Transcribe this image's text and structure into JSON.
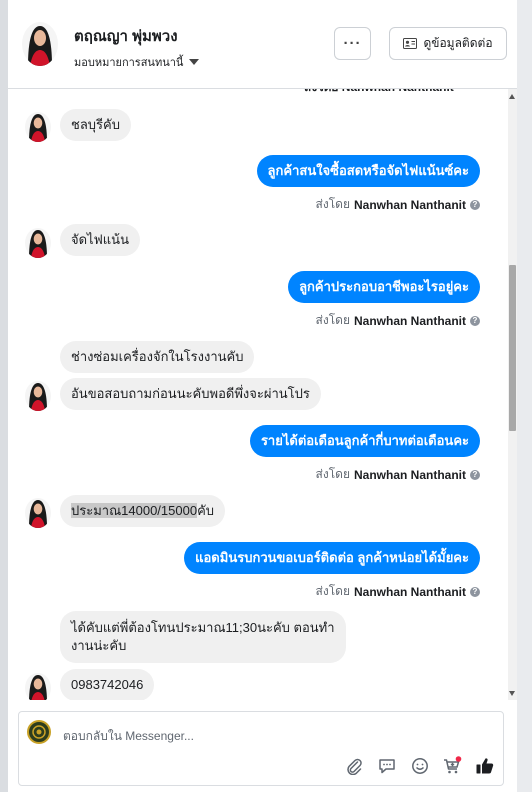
{
  "header": {
    "name": "ตฤณญา พุ่มพวง",
    "assign_label": "มอบหมายการสนทนานี้",
    "more_label": "···",
    "contact_label": "ดูข้อมูลติดต่อ"
  },
  "chat": {
    "top_partial_sentby": "ส่งโดย Nanwhan Nanthanit",
    "messages": [
      {
        "dir": "in",
        "text": "ชลบุรีคับ"
      },
      {
        "dir": "out",
        "text": "ลูกค้าสนใจซื้อสดหรือจัดไฟแน้นซ์คะ",
        "sent_by_prefix": "ส่งโดย",
        "sent_by_name": "Nanwhan Nanthanit"
      },
      {
        "dir": "in",
        "text": "จัดไฟแน้น"
      },
      {
        "dir": "out",
        "text": "ลูกค้าประกอบอาชีพอะไรอยู่คะ",
        "sent_by_prefix": "ส่งโดย",
        "sent_by_name": "Nanwhan Nanthanit"
      },
      {
        "dir": "in",
        "text": "ช่างซ่อมเครื่องจักในโรงงานคับ"
      },
      {
        "dir": "in",
        "text": "อันขอสอบถามก่อนนะคับพอดีพึ่งจะผ่านโปร"
      },
      {
        "dir": "out",
        "text": "รายได้ต่อเดือนลูกค้ากี่บาทต่อเดือนคะ",
        "sent_by_prefix": "ส่งโดย",
        "sent_by_name": "Nanwhan Nanthanit"
      },
      {
        "dir": "in",
        "text_highlight": "ประมาณ14000/15000",
        "text_rest": "คับ"
      },
      {
        "dir": "out",
        "text": "แอดมินรบกวนขอเบอร์ติดต่อ ลูกค้าหน่อยได้มั้ยคะ",
        "sent_by_prefix": "ส่งโดย",
        "sent_by_name": "Nanwhan Nanthanit"
      },
      {
        "dir": "in",
        "text_line1": "ได้คับแต่พี่ต้องโทนประมาณ11;30นะคับ ตอนทำ",
        "text_line2": "งานน่ะคับ"
      },
      {
        "dir": "in",
        "text": "0983742046"
      }
    ]
  },
  "composer": {
    "placeholder": "ตอบกลับใน Messenger...",
    "tools": [
      "paperclip-icon",
      "speech-bubble-icon",
      "emoji-icon",
      "cart-add-icon",
      "thumbs-up-icon"
    ]
  },
  "colors": {
    "accent": "#0084ff",
    "incoming_bubble": "#f0f0f0",
    "like": "#1c1e21",
    "notify_dot": "#f02849"
  }
}
